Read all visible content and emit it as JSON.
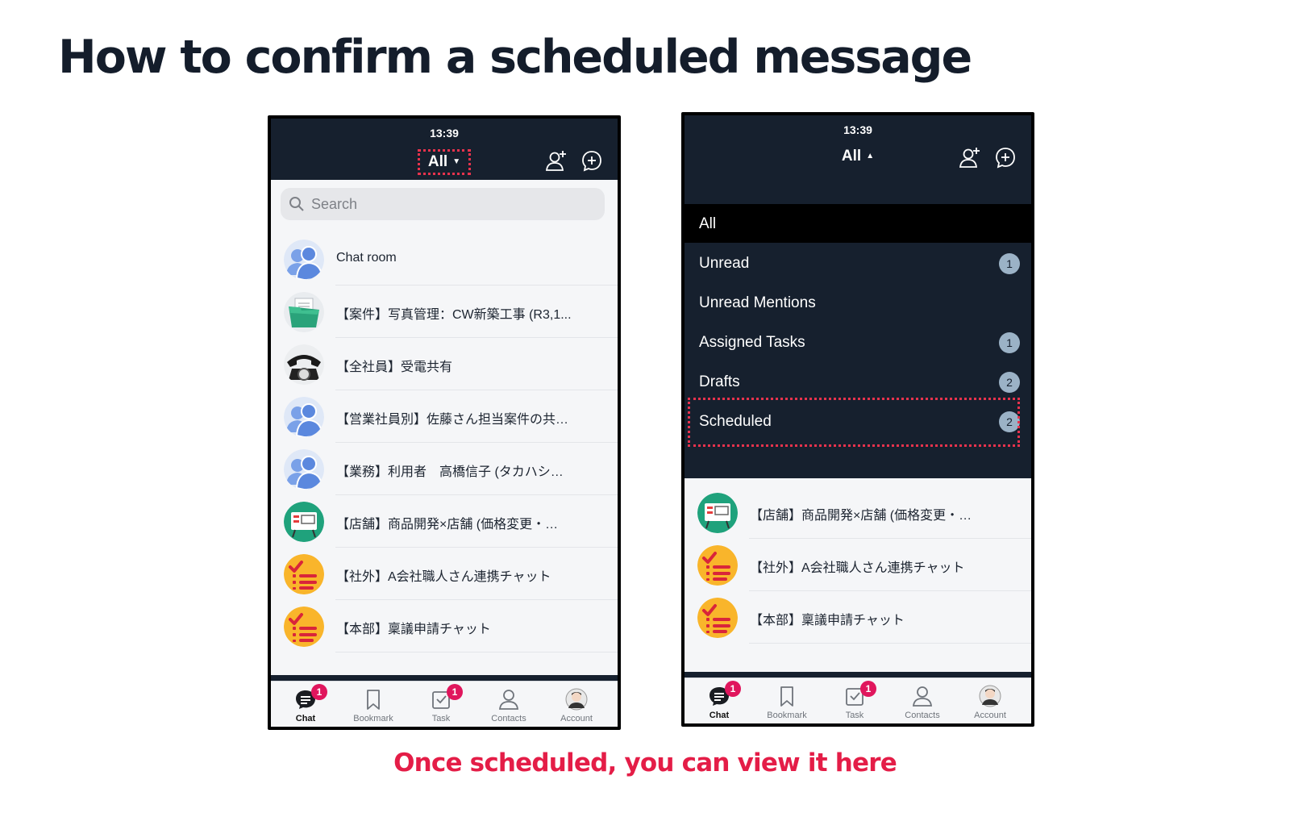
{
  "slide": {
    "title": "How to confirm a scheduled message",
    "caption": "Once scheduled, you can view it here"
  },
  "colors": {
    "navy": "#16202e",
    "highlight_red": "#e8334d",
    "caption_red": "#e41d47",
    "badge_pink": "#e0165d",
    "badge_blue": "#9bb2c6"
  },
  "left_phone": {
    "status_time": "13:39",
    "filter_label": "All",
    "search_placeholder": "Search",
    "chats": [
      {
        "label": "Chat room",
        "icon": "group-avatar-icon"
      },
      {
        "label": "【案件】写真管理：CW新築工事 (R3,1...",
        "icon": "folder-photo-icon"
      },
      {
        "label": "【全社員】受電共有",
        "icon": "telephone-icon"
      },
      {
        "label": "【営業社員別】佐藤さん担当案件の共…",
        "icon": "group-avatar-icon"
      },
      {
        "label": "【業務】利用者　高橋信子 (タカハシ…",
        "icon": "group-avatar-icon"
      },
      {
        "label": "【店舗】商品開発×店舗 (価格変更・…",
        "icon": "whiteboard-icon"
      },
      {
        "label": "【社外】A会社職人さん連携チャット",
        "icon": "checklist-icon"
      },
      {
        "label": "【本部】稟議申請チャット",
        "icon": "checklist-icon"
      }
    ],
    "tabs": [
      {
        "label": "Chat",
        "icon": "chat-icon",
        "badge": "1",
        "active": true
      },
      {
        "label": "Bookmark",
        "icon": "bookmark-icon"
      },
      {
        "label": "Task",
        "icon": "task-icon",
        "badge": "1"
      },
      {
        "label": "Contacts",
        "icon": "contacts-icon"
      },
      {
        "label": "Account",
        "icon": "account-avatar-icon"
      }
    ]
  },
  "right_phone": {
    "status_time": "13:39",
    "filter_label": "All",
    "menu": [
      {
        "label": "All",
        "selected": true
      },
      {
        "label": "Unread",
        "badge": "1"
      },
      {
        "label": "Unread Mentions"
      },
      {
        "label": "Assigned Tasks",
        "badge": "1"
      },
      {
        "label": "Drafts",
        "badge": "2"
      },
      {
        "label": "Scheduled",
        "badge": "2",
        "highlighted": true
      }
    ],
    "chats": [
      {
        "label": "【店舗】商品開発×店舗 (価格変更・…",
        "icon": "whiteboard-icon"
      },
      {
        "label": "【社外】A会社職人さん連携チャット",
        "icon": "checklist-icon"
      },
      {
        "label": "【本部】稟議申請チャット",
        "icon": "checklist-icon"
      }
    ],
    "tabs": [
      {
        "label": "Chat",
        "icon": "chat-icon",
        "badge": "1",
        "active": true
      },
      {
        "label": "Bookmark",
        "icon": "bookmark-icon"
      },
      {
        "label": "Task",
        "icon": "task-icon",
        "badge": "1"
      },
      {
        "label": "Contacts",
        "icon": "contacts-icon"
      },
      {
        "label": "Account",
        "icon": "account-avatar-icon"
      }
    ]
  }
}
